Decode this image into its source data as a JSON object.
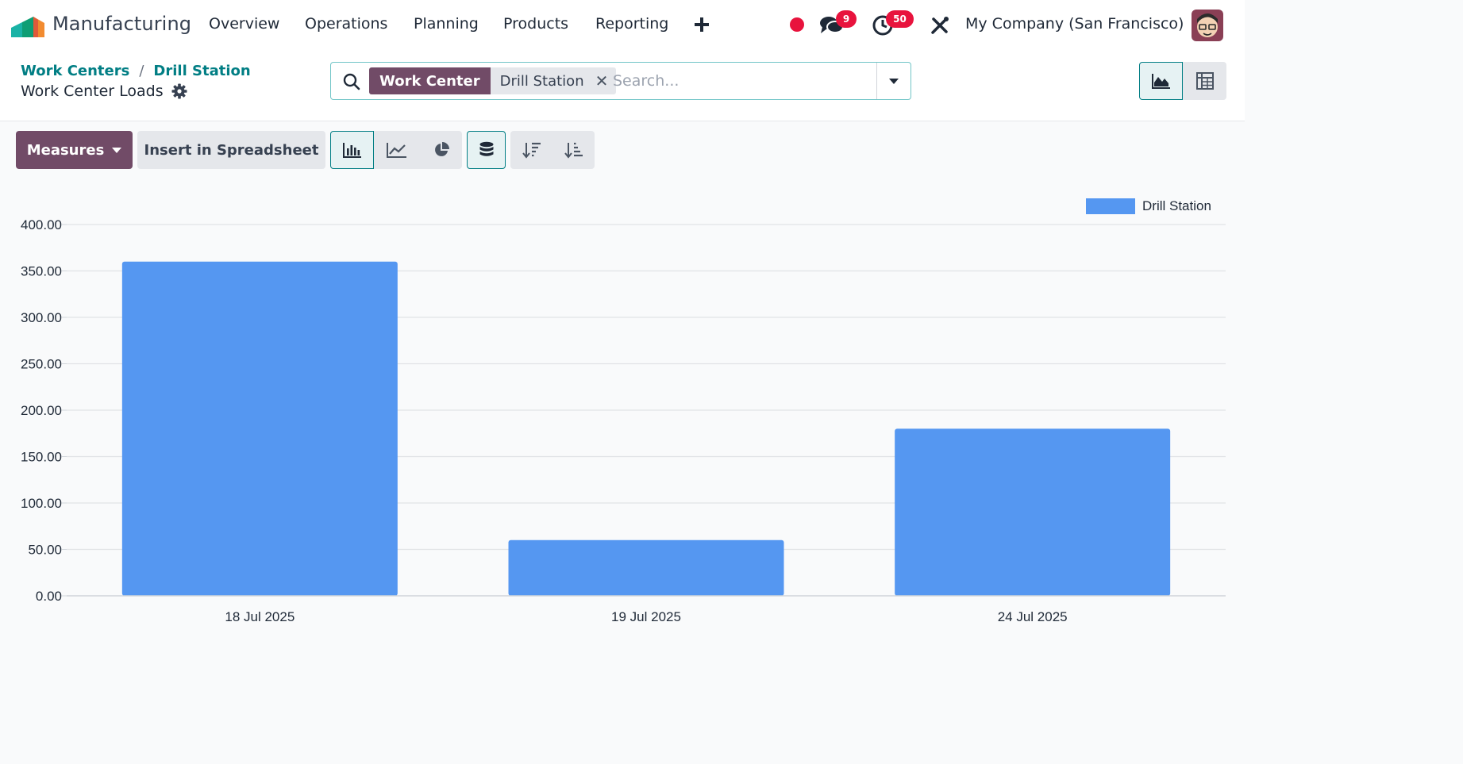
{
  "navbar": {
    "app_name": "Manufacturing",
    "menu": [
      "Overview",
      "Operations",
      "Planning",
      "Products",
      "Reporting"
    ],
    "messages_count": "9",
    "activities_count": "50",
    "company": "My Company (San Francisco)"
  },
  "breadcrumb": {
    "items": [
      "Work Centers",
      "Drill Station"
    ],
    "separator": "/"
  },
  "page": {
    "title": "Work Center Loads"
  },
  "search": {
    "facet_label": "Work Center",
    "facet_value": "Drill Station",
    "placeholder": "Search..."
  },
  "toolbar": {
    "measures_label": "Measures",
    "spreadsheet_label": "Insert in Spreadsheet"
  },
  "colors": {
    "brand": "#714b67",
    "accent": "#017e84",
    "bar": "#5597f1",
    "notification": "#e8133d"
  },
  "icons": [
    "search-icon",
    "chevron-down-icon",
    "gear-icon",
    "area-chart-icon",
    "pivot-table-icon",
    "bar-chart-icon",
    "line-chart-icon",
    "pie-chart-icon",
    "stacked-icon",
    "sort-descending-icon",
    "sort-ascending-icon",
    "close-icon",
    "plus-icon",
    "chat-icon",
    "clock-icon",
    "tools-icon"
  ],
  "chart_data": {
    "type": "bar",
    "categories": [
      "18 Jul 2025",
      "19 Jul 2025",
      "24 Jul 2025"
    ],
    "series": [
      {
        "name": "Drill Station",
        "values": [
          360,
          60,
          180
        ]
      }
    ],
    "ylim": [
      0,
      400
    ],
    "yticks": [
      "0.00",
      "50.00",
      "100.00",
      "150.00",
      "200.00",
      "250.00",
      "300.00",
      "350.00",
      "400.00"
    ],
    "grid": true,
    "legend": "top-right"
  }
}
